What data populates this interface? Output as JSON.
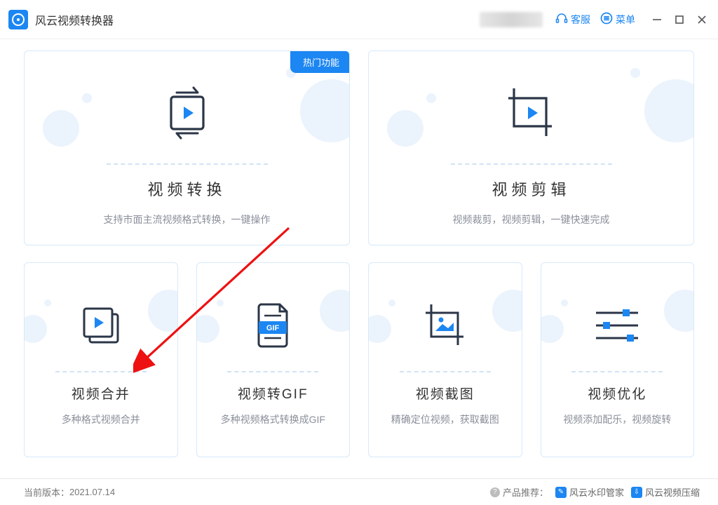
{
  "titlebar": {
    "app_title": "风云视频转换器",
    "support_label": "客服",
    "menu_label": "菜单"
  },
  "cards": {
    "convert": {
      "badge": "热门功能",
      "title": "视频转换",
      "desc": "支持市面主流视频格式转换，一键操作"
    },
    "edit": {
      "title": "视频剪辑",
      "desc": "视频裁剪，视频剪辑，一键快速完成"
    },
    "merge": {
      "title": "视频合并",
      "desc": "多种格式视频合并"
    },
    "gif": {
      "title": "视频转GIF",
      "desc": "多种视频格式转换成GIF",
      "gif_badge": "GIF"
    },
    "screenshot": {
      "title": "视频截图",
      "desc": "精确定位视频，获取截图"
    },
    "optimize": {
      "title": "视频优化",
      "desc": "视频添加配乐，视频旋转"
    }
  },
  "footer": {
    "version_label": "当前版本：",
    "version_value": "2021.07.14",
    "recommend_label": "产品推荐：",
    "reco_items": [
      "风云水印管家",
      "风云视频压缩"
    ]
  }
}
